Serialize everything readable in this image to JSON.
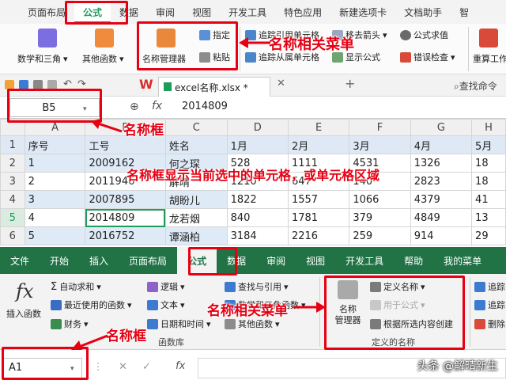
{
  "wps": {
    "tabs": [
      "页面布局",
      "公式",
      "数据",
      "审阅",
      "视图",
      "开发工具",
      "特色应用",
      "新建选项卡",
      "文档助手",
      "智"
    ],
    "ribbon": {
      "math_func": "数学和三角",
      "other_func": "其他函数",
      "name_manager": "名称管理器",
      "define": "指定",
      "paste": "粘贴",
      "trace_precedents": "追踪引用单元格",
      "trace_dependents": "追踪从属单元格",
      "remove_arrows": "移去箭头",
      "show_formulas": "显示公式",
      "evaluate": "公式求值",
      "error_check": "错误检查",
      "recalc": "重算工作"
    },
    "doc_tab": "excel名称.xlsx *",
    "search_cmd": "查找命令",
    "name_box": "B5",
    "formula_value": "2014809"
  },
  "sheet": {
    "col_letters": [
      "A",
      "B",
      "C",
      "D",
      "E",
      "F",
      "G",
      "H"
    ],
    "row_numbers": [
      "1",
      "2",
      "3",
      "4",
      "5",
      "6"
    ],
    "rows": [
      [
        "序号",
        "工号",
        "姓名",
        "1月",
        "2月",
        "3月",
        "4月",
        "5月"
      ],
      [
        "1",
        "2009162",
        "何之琛",
        "528",
        "1111",
        "4531",
        "1326",
        "18"
      ],
      [
        "2",
        "2011946",
        "解晴",
        "1210",
        "647",
        "140",
        "2823",
        "18"
      ],
      [
        "3",
        "2007895",
        "胡盼儿",
        "1822",
        "1557",
        "1066",
        "4379",
        "41"
      ],
      [
        "4",
        "2014809",
        "龙若烟",
        "840",
        "1781",
        "379",
        "4849",
        "13"
      ],
      [
        "5",
        "2016752",
        "谭涵柏",
        "3184",
        "2216",
        "259",
        "914",
        "29"
      ]
    ]
  },
  "excel": {
    "tabs": [
      "文件",
      "开始",
      "插入",
      "页面布局",
      "公式",
      "数据",
      "审阅",
      "视图",
      "开发工具",
      "帮助",
      "我的菜单"
    ],
    "ribbon": {
      "insert_func": "插入函数",
      "autosum": "自动求和",
      "recent": "最近使用的函数",
      "finance": "财务",
      "logical": "逻辑",
      "text": "文本",
      "datetime": "日期和时间",
      "lookup": "查找与引用",
      "math": "数学和三角函数",
      "more": "其他函数",
      "library_label": "函数库",
      "name_manager_1": "名称",
      "name_manager_2": "管理器",
      "define_name": "定义名称",
      "use_in_formula": "用于公式",
      "create_from_sel": "根据所选内容创建",
      "defined_names_label": "定义的名称",
      "trace1": "追踪",
      "trace2": "追踪",
      "remove": "删除"
    },
    "name_box": "A1",
    "fx": "fx"
  },
  "annotations": {
    "wps_menu": "名称相关菜单",
    "wps_namebox": "名称框",
    "overlay": "名称框显示当前选中的单元格，或单元格区域",
    "xl_menu": "名称相关菜单",
    "xl_namebox": "名称框"
  },
  "watermark": "头条 @解晴新生",
  "colors": {
    "wps_green": "#1e9c5a",
    "excel_green": "#217346",
    "annotation_red": "#e60012"
  }
}
